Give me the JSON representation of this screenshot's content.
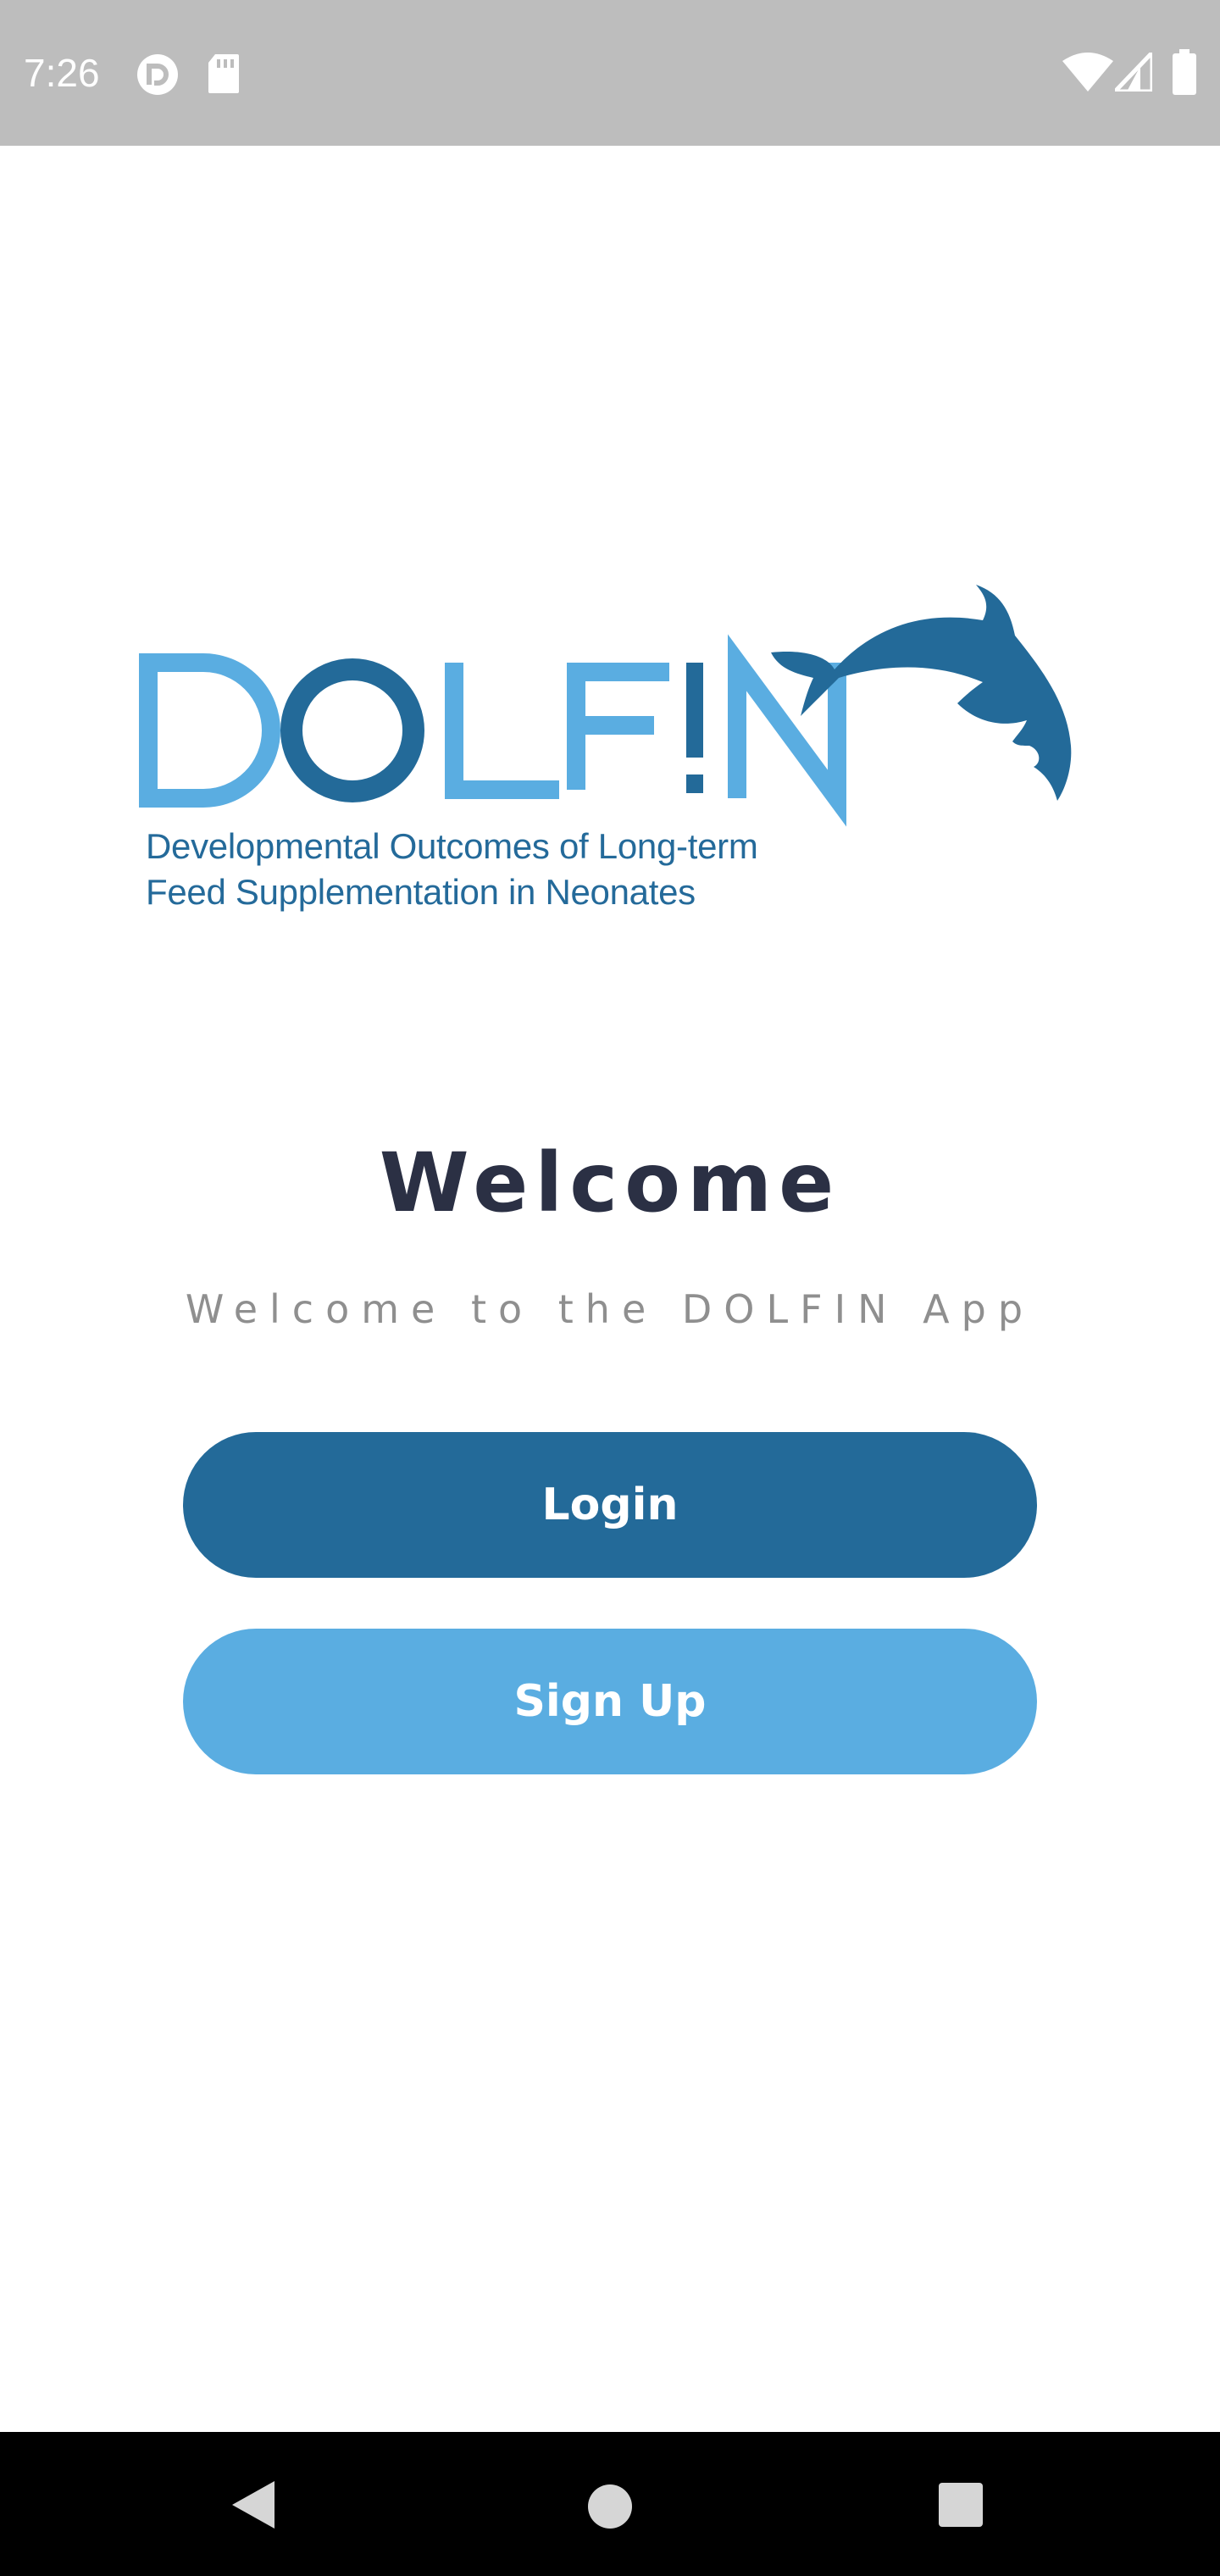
{
  "status_bar": {
    "time": "7:26",
    "left_icons": [
      "pocket-casts-icon",
      "sd-card-icon"
    ],
    "right_icons": [
      "wifi-icon",
      "cell-signal-icon",
      "battery-icon"
    ]
  },
  "logo": {
    "wordmark": "DOLFIN",
    "tagline_line1": "Developmental Outcomes of Long-term",
    "tagline_line2": "Feed Supplementation in Neonates",
    "colors": {
      "light_blue": "#5aade1",
      "dark_blue": "#236a99"
    }
  },
  "welcome": {
    "title": "Welcome",
    "subtitle": "Welcome to the DOLFIN App"
  },
  "buttons": {
    "login": "Login",
    "signup": "Sign Up"
  },
  "nav_bar": {
    "icons": [
      "back-icon",
      "home-icon",
      "recents-icon"
    ]
  }
}
